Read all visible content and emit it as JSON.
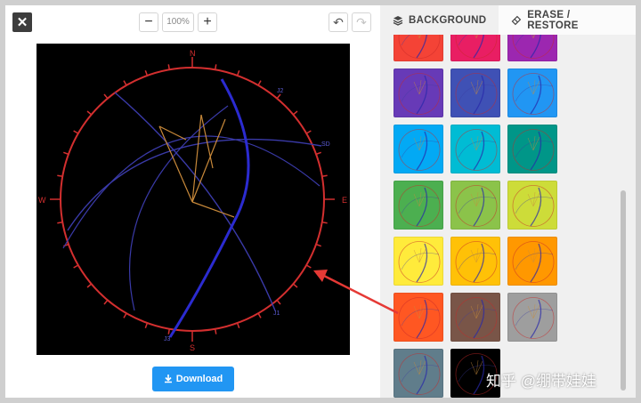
{
  "toolbar": {
    "close_label": "✕",
    "zoom_out_label": "−",
    "zoom_level": "100%",
    "zoom_in_label": "+",
    "undo_label": "↶",
    "redo_label": "↷"
  },
  "canvas": {
    "label_n": "N",
    "label_s": "S",
    "label_e": "E",
    "label_w": "W",
    "label_j1": "J1",
    "label_j2": "J2",
    "label_sd": "SD",
    "label_j3": "J3"
  },
  "download": {
    "label": "Download",
    "icon": "download-icon"
  },
  "tabs": {
    "background": {
      "label": "BACKGROUND",
      "icon": "layers-icon"
    },
    "erase": {
      "label": "ERASE / RESTORE",
      "icon": "eraser-icon"
    }
  },
  "swatches": [
    {
      "color": "#f44336"
    },
    {
      "color": "#e91e63"
    },
    {
      "color": "#9c27b0"
    },
    {
      "color": "#673ab7"
    },
    {
      "color": "#3f51b5"
    },
    {
      "color": "#2196f3"
    },
    {
      "color": "#03a9f4"
    },
    {
      "color": "#00bcd4"
    },
    {
      "color": "#009688"
    },
    {
      "color": "#4caf50"
    },
    {
      "color": "#8bc34a"
    },
    {
      "color": "#cddc39"
    },
    {
      "color": "#ffeb3b"
    },
    {
      "color": "#ffc107"
    },
    {
      "color": "#ff9800"
    },
    {
      "color": "#ff5722"
    },
    {
      "color": "#795548"
    },
    {
      "color": "#9e9e9e"
    },
    {
      "color": "#607d8b"
    },
    {
      "color": "#000000"
    }
  ],
  "watermark": "知乎 @绷带娃娃"
}
